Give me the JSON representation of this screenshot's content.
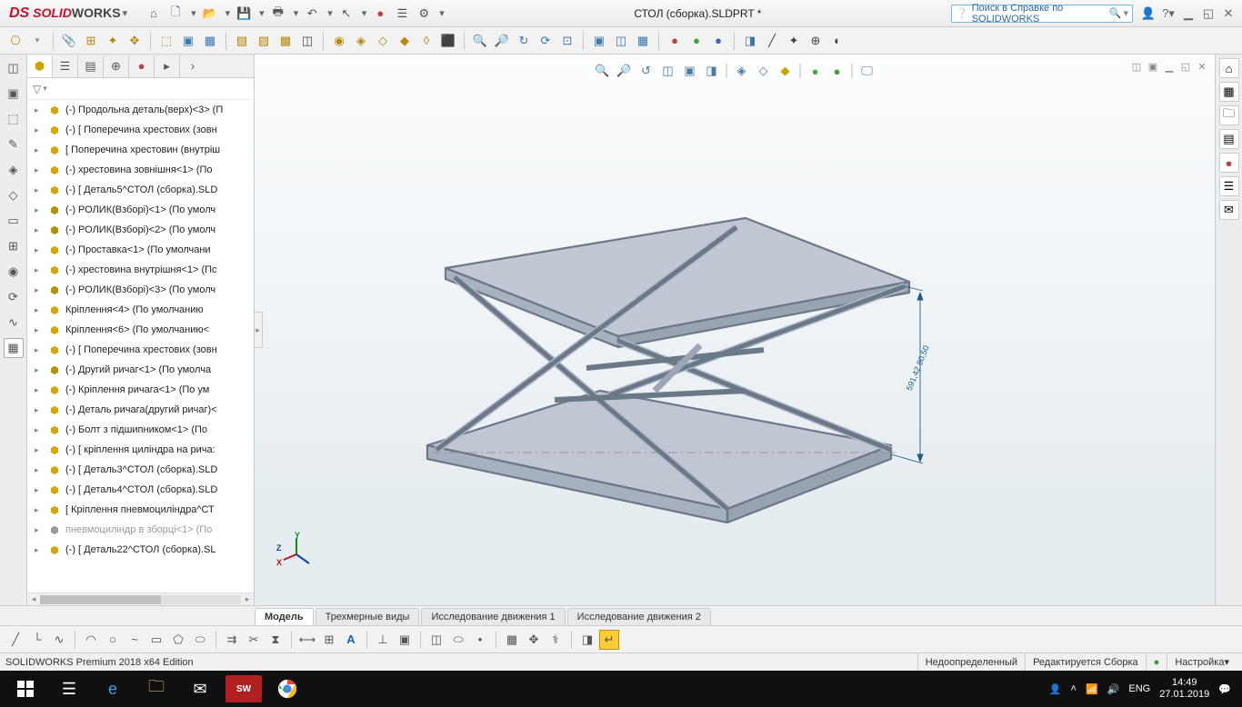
{
  "title": {
    "logo_ds": "DS",
    "logo_solid": "SOLID",
    "logo_works": "WORKS",
    "document": "СТОЛ (сборка).SLDPRT *",
    "search_placeholder": "Поиск в Справке по SOLIDWORKS"
  },
  "tree": {
    "items": [
      {
        "icon": "g1",
        "label": "(-) Продольна деталь(верх)<3> (П"
      },
      {
        "icon": "g1",
        "label": "(-) [ Поперечина хрестових (зовн"
      },
      {
        "icon": "g1",
        "label": "[ Поперечина хрестовин (внутріш"
      },
      {
        "icon": "g1",
        "label": "(-) хрестовина зовнішня<1> (По "
      },
      {
        "icon": "g1",
        "label": "(-) [ Деталь5^СТОЛ (сборка).SLD"
      },
      {
        "icon": "sub",
        "label": "(-) РОЛИК(Взборі)<1> (По умолч"
      },
      {
        "icon": "sub",
        "label": "(-) РОЛИК(Взборі)<2> (По умолч"
      },
      {
        "icon": "g1",
        "label": "(-) Проставка<1> (По умолчани"
      },
      {
        "icon": "g1",
        "label": "(-) хрестовина внутрішня<1> (Пс"
      },
      {
        "icon": "sub",
        "label": "(-) РОЛИК(Взборі)<3> (По умолч"
      },
      {
        "icon": "g1",
        "label": "Кріплення<4> (По умолчанию"
      },
      {
        "icon": "g1",
        "label": "Кріплення<6> (По умолчанию<"
      },
      {
        "icon": "g1",
        "label": "(-) [ Поперечина хрестових (зовн"
      },
      {
        "icon": "sub",
        "label": "(-) Другий ричаг<1> (По умолча"
      },
      {
        "icon": "g1",
        "label": "(-) Кріплення ричага<1> (По ум"
      },
      {
        "icon": "g1",
        "label": "(-) Деталь ричага(другий ричаг)<"
      },
      {
        "icon": "g1",
        "label": "(-) Болт з підшипником<1> (По"
      },
      {
        "icon": "g1",
        "label": "(-) [ кріплення циліндра на рича:"
      },
      {
        "icon": "g1",
        "label": "(-) [ Деталь3^СТОЛ (сборка).SLD"
      },
      {
        "icon": "g1",
        "label": "(-) [ Деталь4^СТОЛ (сборка).SLD"
      },
      {
        "icon": "g1",
        "label": "[ Кріплення пневмоциліндра^СТ"
      },
      {
        "icon": "grey",
        "label": "пневмоциліндр в зборці<1> (По"
      },
      {
        "icon": "g1",
        "label": "(-) [ Деталь22^СТОЛ (сборка).SL"
      }
    ]
  },
  "bottom_tabs": {
    "t1": "Модель",
    "t2": "Трехмерные виды",
    "t3": "Исследование движения 1",
    "t4": "Исследование движения 2"
  },
  "viewport": {
    "dimension": "591,42 80,50"
  },
  "status": {
    "edition": "SOLIDWORKS Premium 2018 x64 Edition",
    "state": "Недоопределенный",
    "mode": "Редактируется Сборка",
    "custom": "Настройка"
  },
  "taskbar": {
    "lang": "ENG",
    "time": "14:49",
    "date": "27.01.2019",
    "sw": "SW"
  },
  "triad": {
    "x": "X",
    "y": "Y",
    "z": "Z"
  }
}
